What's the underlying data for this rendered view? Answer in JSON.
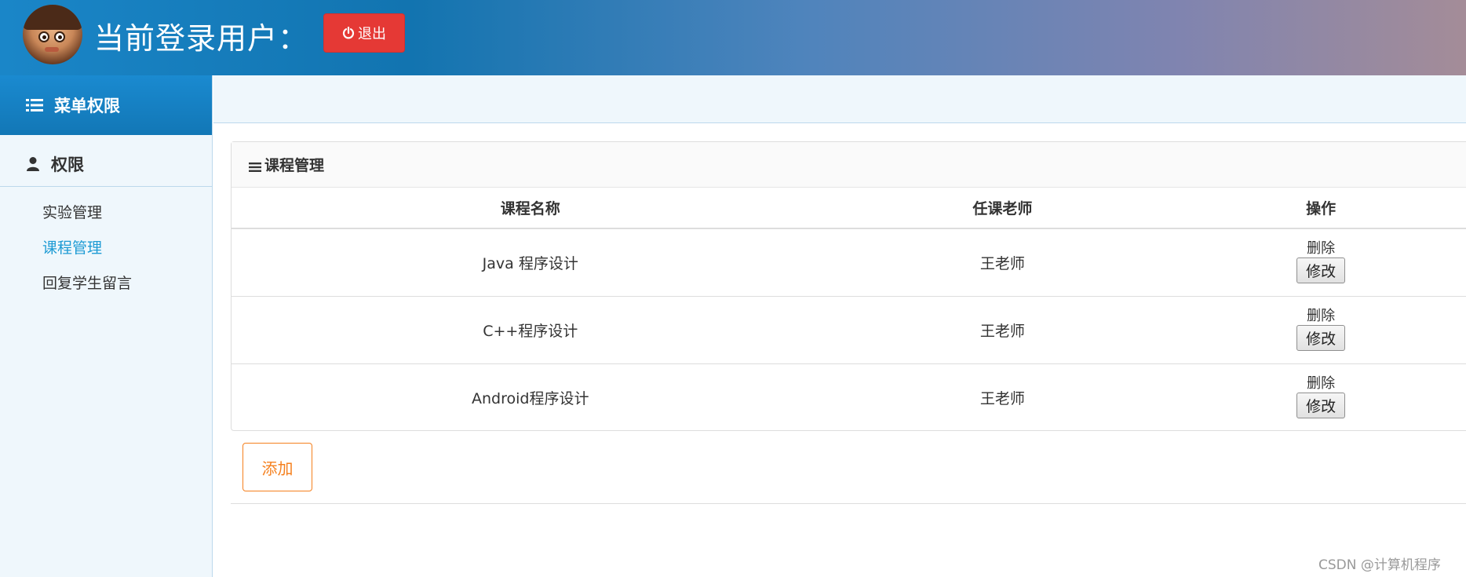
{
  "header": {
    "title": "当前登录用户：",
    "logout_label": "退出"
  },
  "sidebar": {
    "heading": "菜单权限",
    "section": "权限",
    "items": [
      {
        "label": "实验管理",
        "active": false
      },
      {
        "label": "课程管理",
        "active": true
      },
      {
        "label": "回复学生留言",
        "active": false
      }
    ]
  },
  "panel": {
    "title": "课程管理",
    "columns": [
      "课程名称",
      "任课老师",
      "操作"
    ],
    "rows": [
      {
        "name": "Java 程序设计",
        "teacher": "王老师",
        "delete": "删除",
        "edit": "修改"
      },
      {
        "name": "C++程序设计",
        "teacher": "王老师",
        "delete": "删除",
        "edit": "修改"
      },
      {
        "name": "Android程序设计",
        "teacher": "王老师",
        "delete": "删除",
        "edit": "修改"
      }
    ]
  },
  "add_label": "添加",
  "watermark": "CSDN @计算机程序",
  "colors": {
    "logout": "#e53935",
    "sidebar_active": "#1e9bd4",
    "add_button": "#f5801e"
  }
}
